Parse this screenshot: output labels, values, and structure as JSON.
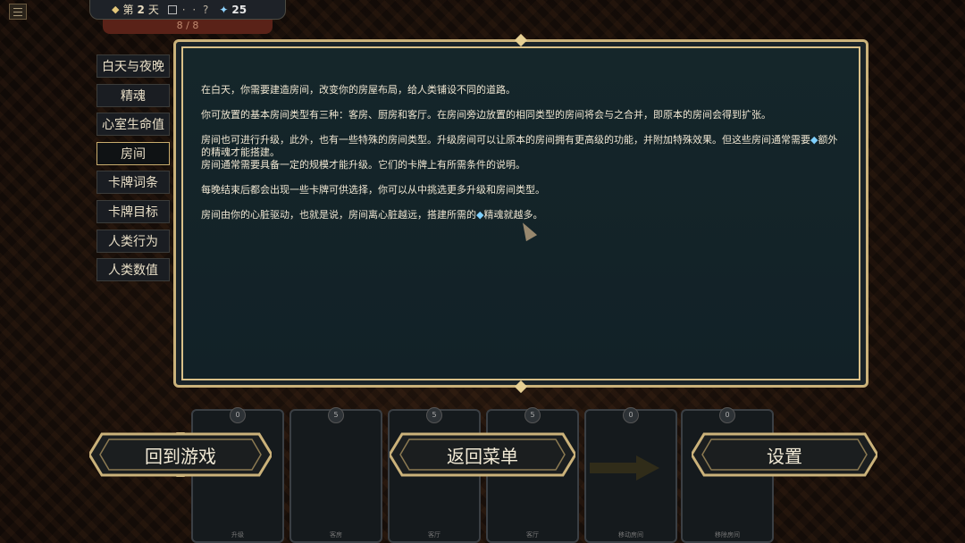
{
  "top_bar": {
    "day_label": "第",
    "day_number": "2",
    "day_unit": "天",
    "dots": "· ·",
    "question": "?",
    "essence_value": "25",
    "sub_progress": "8 / 8"
  },
  "tabs": [
    {
      "label": "白天与夜晚",
      "active": false
    },
    {
      "label": "精魂",
      "active": false
    },
    {
      "label": "心室生命值",
      "active": false
    },
    {
      "label": "房间",
      "active": true
    },
    {
      "label": "卡牌词条",
      "active": false
    },
    {
      "label": "卡牌目标",
      "active": false
    },
    {
      "label": "人类行为",
      "active": false
    },
    {
      "label": "人类数值",
      "active": false
    }
  ],
  "content": {
    "p1": "在白天，你需要建造房间，改变你的房屋布局，给人类铺设不同的道路。",
    "p2": "你可放置的基本房间类型有三种：客房、厨房和客厅。在房间旁边放置的相同类型的房间将会与之合并，即原本的房间会得到扩张。",
    "p3a": "房间也可进行升级，此外，也有一些特殊的房间类型。升级房间可以让原本的房间拥有更高级的功能，并附加特殊效果。但这些房间通常需要",
    "p3b": "额外的精魂才能搭建。",
    "p3c": "房间通常需要具备一定的规模才能升级。它们的卡牌上有所需条件的说明。",
    "p4": "每晚结束后都会出现一些卡牌可供选择，你可以从中挑选更多升级和房间类型。",
    "p5a": "房间由你的心脏驱动，也就是说，房间离心脏越远，搭建所需的",
    "p5b": "精魂就越多。",
    "gem_glyph": "◆"
  },
  "cards": [
    {
      "cost": "0",
      "name": "升级"
    },
    {
      "cost": "5",
      "name": "客房"
    },
    {
      "cost": "5",
      "name": "客厅"
    },
    {
      "cost": "5",
      "name": "客厅"
    },
    {
      "cost": "0",
      "name": "移动房间"
    },
    {
      "cost": "0",
      "name": "移除房间"
    }
  ],
  "buttons": {
    "back_to_game": "回到游戏",
    "back_to_menu": "返回菜单",
    "settings": "设置"
  },
  "colors": {
    "gold": "#cbb27a",
    "panel_bg": "#15262a",
    "essence": "#8fd3ff"
  }
}
